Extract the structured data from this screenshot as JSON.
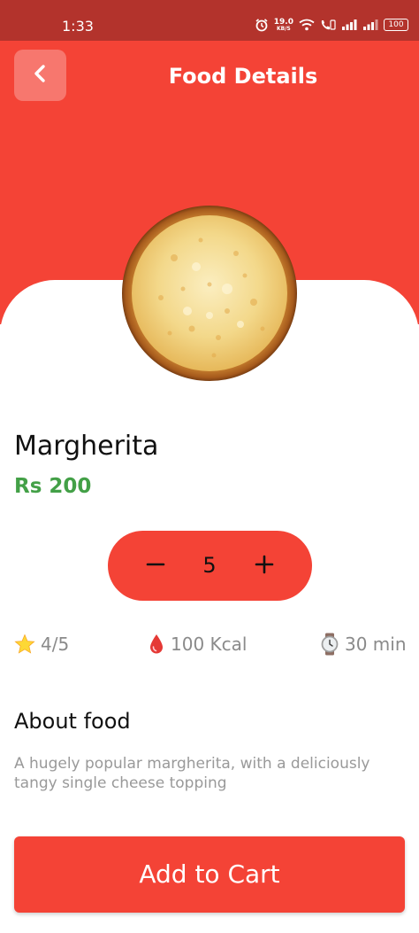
{
  "status_bar": {
    "time": "1:33",
    "net_speed_value": "19.0",
    "net_speed_unit": "KB/S",
    "battery": "100",
    "icons": [
      "alarm-icon",
      "wifi-icon",
      "volte-call-icon",
      "signal-icon",
      "signal-icon",
      "battery-icon"
    ]
  },
  "header": {
    "title": "Food Details",
    "back_icon": "chevron-left-icon"
  },
  "food": {
    "image_icon": "pizza-image",
    "name": "Margherita",
    "price": "Rs 200"
  },
  "quantity": {
    "value": "5",
    "minus_icon": "minus-icon",
    "plus_icon": "plus-icon"
  },
  "stats": {
    "rating": "4/5",
    "calories": "100 Kcal",
    "time": "30 min",
    "rating_icon": "star-icon",
    "calories_icon": "drop-icon",
    "time_icon": "watch-icon"
  },
  "about": {
    "title": "About food",
    "text": "A hugely popular margherita, with a deliciously tangy single cheese topping"
  },
  "cart_button": {
    "label": "Add to Cart"
  },
  "colors": {
    "primary": "#f44336",
    "status_bar": "#b3332c",
    "price": "#43a047",
    "muted_text": "#999999"
  }
}
